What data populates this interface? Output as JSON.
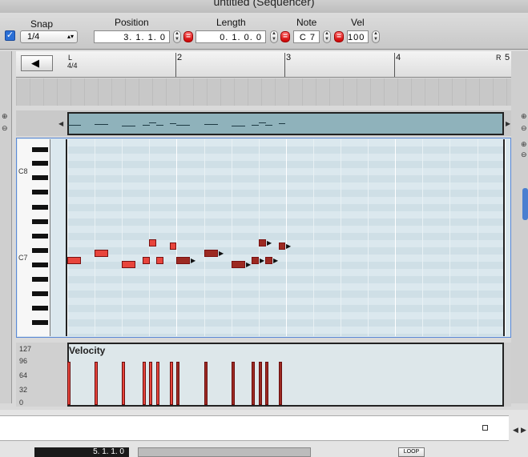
{
  "window": {
    "title": "untitled (Sequencer)"
  },
  "toolbar": {
    "snap_label": "Snap",
    "snap_value": "1/4",
    "position_label": "Position",
    "position_value": "3.  1.  1.    0",
    "length_label": "Length",
    "length_value": "0.  1.  0.    0",
    "note_label": "Note",
    "note_value": "C 7",
    "vel_label": "Vel",
    "vel_value": "100",
    "equal_glyph": "="
  },
  "ruler": {
    "bars": [
      "2",
      "3",
      "4",
      "5"
    ],
    "time_signature": "4/4",
    "left_marker": "L",
    "right_marker": "R"
  },
  "keyboard": {
    "labels": [
      "C8",
      "C7"
    ]
  },
  "velocity": {
    "title": "Velocity",
    "axis_labels": [
      "127",
      "96",
      "64",
      "32",
      "0"
    ],
    "values": [
      96,
      96,
      96,
      96,
      96,
      96,
      96,
      96,
      96,
      96,
      96,
      96,
      96,
      96,
      96
    ]
  },
  "notes": [
    {
      "start": 0,
      "pitch": "C7",
      "dur": 0.5,
      "selected": true
    },
    {
      "start": 1,
      "pitch": "D7",
      "dur": 0.5,
      "selected": true
    },
    {
      "start": 2,
      "pitch": "B6",
      "dur": 0.5,
      "selected": true
    },
    {
      "start": 2.75,
      "pitch": "C7",
      "dur": 0.25,
      "selected": true
    },
    {
      "start": 3,
      "pitch": "F7",
      "dur": 0.25,
      "selected": true
    },
    {
      "start": 3.25,
      "pitch": "C7",
      "dur": 0.25,
      "selected": true
    },
    {
      "start": 3.75,
      "pitch": "E7",
      "dur": 0.125,
      "selected": true
    },
    {
      "start": 4,
      "pitch": "C7",
      "dur": 0.5,
      "selected": false
    },
    {
      "start": 5,
      "pitch": "D7",
      "dur": 0.5,
      "selected": false
    },
    {
      "start": 6,
      "pitch": "B6",
      "dur": 0.5,
      "selected": false
    },
    {
      "start": 6.75,
      "pitch": "C7",
      "dur": 0.25,
      "selected": false
    },
    {
      "start": 7,
      "pitch": "F7",
      "dur": 0.25,
      "selected": false
    },
    {
      "start": 7.25,
      "pitch": "C7",
      "dur": 0.25,
      "selected": false
    },
    {
      "start": 7.75,
      "pitch": "E7",
      "dur": 0.125,
      "selected": false
    }
  ],
  "transport": {
    "position_value": "5.  1.  1.    0",
    "loop_label": "LOOP"
  },
  "colors": {
    "note_selected": "#e8453c",
    "note_normal": "#9c2a22",
    "selection_border": "#5a88d6",
    "grid_bg": "#dbe8ee"
  }
}
